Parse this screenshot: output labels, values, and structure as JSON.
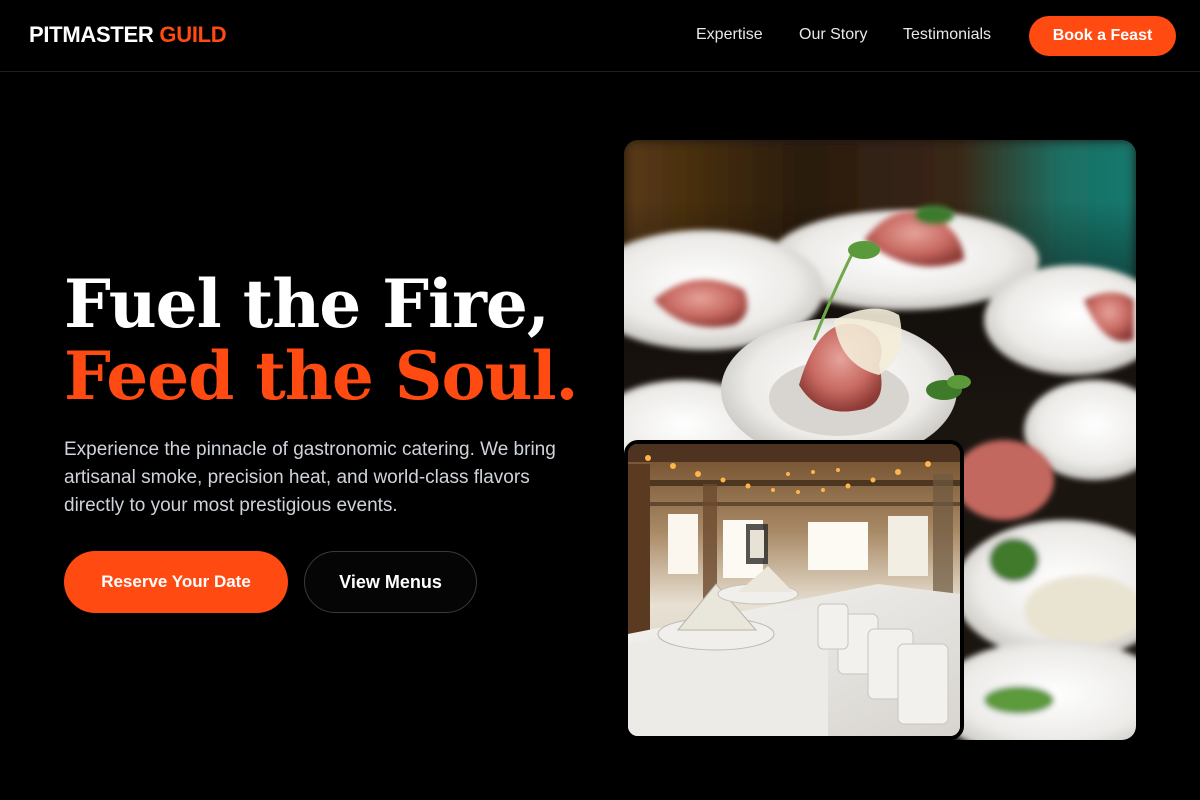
{
  "brand": {
    "name": "PITMASTER",
    "accent": "GUILD"
  },
  "nav": {
    "links": [
      "Expertise",
      "Our Story",
      "Testimonials"
    ],
    "cta": "Book a Feast"
  },
  "hero": {
    "headline_line1": "Fuel the Fire,",
    "headline_line2": "Feed the Soul.",
    "lede": "Experience the pinnacle of gastronomic catering. We bring artisanal smoke, precision heat, and world-class flavors directly to your most prestigious events.",
    "primary_button": "Reserve Your Date",
    "secondary_button": "View Menus"
  },
  "images": {
    "main": "plated-prosciutto-appetizers-photo",
    "inset": "banquet-hall-table-setting-photo"
  },
  "colors": {
    "accent": "#ff4a12",
    "background": "#000000",
    "text": "#ffffff",
    "muted_text": "#cfd3da"
  }
}
